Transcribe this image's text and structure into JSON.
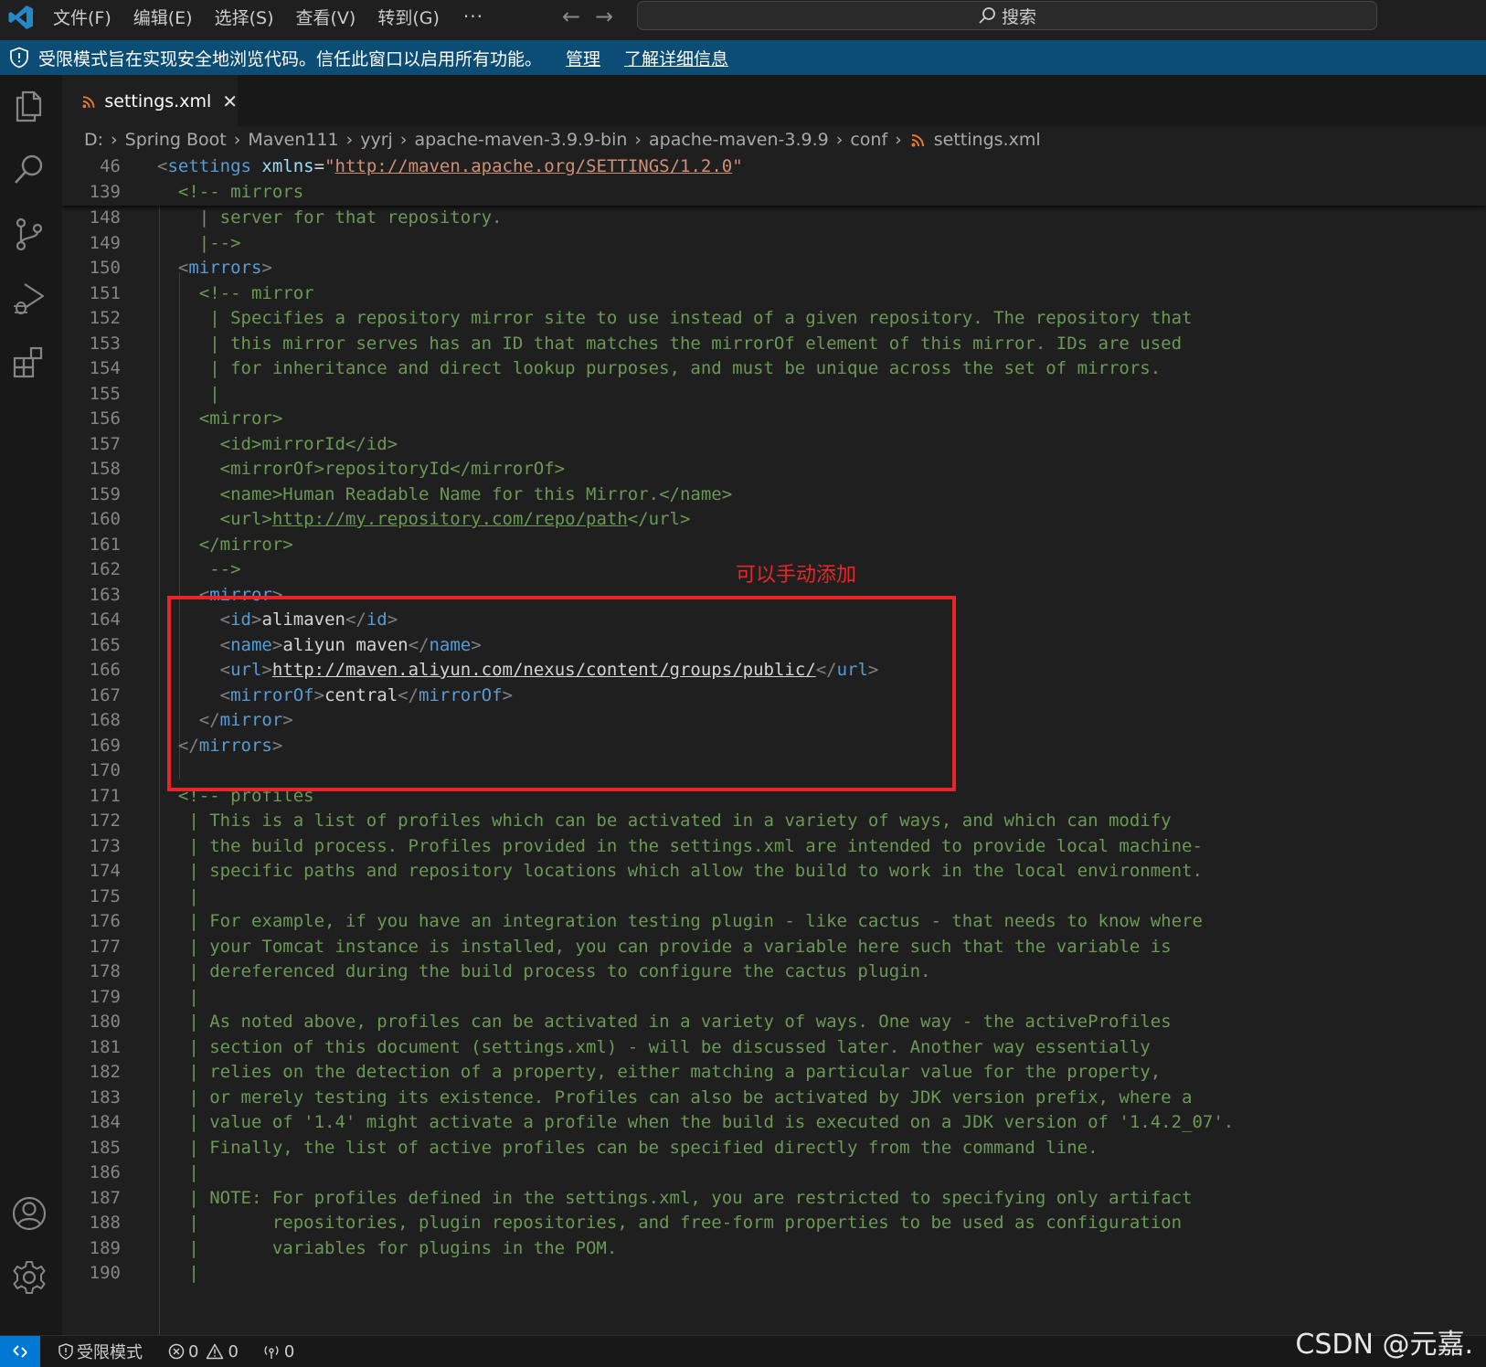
{
  "menu": [
    "文件(F)",
    "编辑(E)",
    "选择(S)",
    "查看(V)",
    "转到(G)"
  ],
  "menu_more": "···",
  "nav": {
    "back": "←",
    "forward": "→"
  },
  "search": {
    "label": "搜索"
  },
  "banner": {
    "message": "受限模式旨在实现安全地浏览代码。信任此窗口以启用所有功能。",
    "manage": "管理",
    "learn_more": "了解详细信息"
  },
  "tab": {
    "label": "settings.xml",
    "close": "✕"
  },
  "breadcrumb": [
    "D:",
    "Spring Boot",
    "Maven111",
    "yyrj",
    "apache-maven-3.9.9-bin",
    "apache-maven-3.9.9",
    "conf",
    "settings.xml"
  ],
  "breadcrumb_sep": "›",
  "editor": {
    "sticky": [
      {
        "n": "46",
        "tokens": [
          [
            "p",
            "<"
          ],
          [
            "t",
            "settings"
          ],
          [
            "d",
            " "
          ],
          [
            "a",
            "xmlns"
          ],
          [
            "d",
            "="
          ],
          [
            "s",
            "\""
          ],
          [
            "su",
            "http://maven.apache.org/SETTINGS/1.2.0"
          ],
          [
            "s",
            "\""
          ]
        ]
      },
      {
        "n": "139",
        "tokens": [
          [
            "d",
            "  "
          ],
          [
            "c",
            "<!-- mirrors"
          ]
        ]
      }
    ],
    "lines": [
      {
        "n": "148",
        "tokens": [
          [
            "c",
            "    | server for that repository."
          ]
        ]
      },
      {
        "n": "149",
        "tokens": [
          [
            "c",
            "    |-->"
          ]
        ]
      },
      {
        "n": "150",
        "tokens": [
          [
            "d",
            "  "
          ],
          [
            "p",
            "<"
          ],
          [
            "t",
            "mirrors"
          ],
          [
            "p",
            ">"
          ]
        ]
      },
      {
        "n": "151",
        "tokens": [
          [
            "c",
            "    <!-- mirror"
          ]
        ]
      },
      {
        "n": "152",
        "tokens": [
          [
            "c",
            "     | Specifies a repository mirror site to use instead of a given repository. The repository that"
          ]
        ]
      },
      {
        "n": "153",
        "tokens": [
          [
            "c",
            "     | this mirror serves has an ID that matches the mirrorOf element of this mirror. IDs are used"
          ]
        ]
      },
      {
        "n": "154",
        "tokens": [
          [
            "c",
            "     | for inheritance and direct lookup purposes, and must be unique across the set of mirrors."
          ]
        ]
      },
      {
        "n": "155",
        "tokens": [
          [
            "c",
            "     |"
          ]
        ]
      },
      {
        "n": "156",
        "tokens": [
          [
            "c",
            "    <mirror>"
          ]
        ]
      },
      {
        "n": "157",
        "tokens": [
          [
            "c",
            "      <id>mirrorId</id>"
          ]
        ]
      },
      {
        "n": "158",
        "tokens": [
          [
            "c",
            "      <mirrorOf>repositoryId</mirrorOf>"
          ]
        ]
      },
      {
        "n": "159",
        "tokens": [
          [
            "c",
            "      <name>Human Readable Name for this Mirror.</name>"
          ]
        ]
      },
      {
        "n": "160",
        "tokens": [
          [
            "c",
            "      <url>"
          ],
          [
            "cu",
            "http://my.repository.com/repo/path"
          ],
          [
            "c",
            "</url>"
          ]
        ]
      },
      {
        "n": "161",
        "tokens": [
          [
            "c",
            "    </mirror>"
          ]
        ]
      },
      {
        "n": "162",
        "tokens": [
          [
            "c",
            "     -->"
          ]
        ]
      },
      {
        "n": "163",
        "tokens": [
          [
            "d",
            "    "
          ],
          [
            "p",
            "<"
          ],
          [
            "t",
            "mirror"
          ],
          [
            "p",
            ">"
          ]
        ]
      },
      {
        "n": "164",
        "tokens": [
          [
            "d",
            "      "
          ],
          [
            "p",
            "<"
          ],
          [
            "t",
            "id"
          ],
          [
            "p",
            ">"
          ],
          [
            "d",
            "alimaven"
          ],
          [
            "p",
            "</"
          ],
          [
            "t",
            "id"
          ],
          [
            "p",
            ">"
          ]
        ]
      },
      {
        "n": "165",
        "tokens": [
          [
            "d",
            "      "
          ],
          [
            "p",
            "<"
          ],
          [
            "t",
            "name"
          ],
          [
            "p",
            ">"
          ],
          [
            "d",
            "aliyun maven"
          ],
          [
            "p",
            "</"
          ],
          [
            "t",
            "name"
          ],
          [
            "p",
            ">"
          ]
        ]
      },
      {
        "n": "166",
        "tokens": [
          [
            "d",
            "      "
          ],
          [
            "p",
            "<"
          ],
          [
            "t",
            "url"
          ],
          [
            "p",
            ">"
          ],
          [
            "tu",
            "http://maven.aliyun.com/nexus/content/groups/public/"
          ],
          [
            "p",
            "</"
          ],
          [
            "t",
            "url"
          ],
          [
            "p",
            ">"
          ]
        ]
      },
      {
        "n": "167",
        "tokens": [
          [
            "d",
            "      "
          ],
          [
            "p",
            "<"
          ],
          [
            "t",
            "mirrorOf"
          ],
          [
            "p",
            ">"
          ],
          [
            "d",
            "central"
          ],
          [
            "p",
            "</"
          ],
          [
            "t",
            "mirrorOf"
          ],
          [
            "p",
            ">"
          ]
        ]
      },
      {
        "n": "168",
        "tokens": [
          [
            "d",
            "    "
          ],
          [
            "p",
            "</"
          ],
          [
            "t",
            "mirror"
          ],
          [
            "p",
            ">"
          ]
        ]
      },
      {
        "n": "169",
        "tokens": [
          [
            "d",
            "  "
          ],
          [
            "p",
            "</"
          ],
          [
            "t",
            "mirrors"
          ],
          [
            "p",
            ">"
          ]
        ]
      },
      {
        "n": "170",
        "tokens": [
          [
            "d",
            ""
          ]
        ]
      },
      {
        "n": "171",
        "tokens": [
          [
            "c",
            "  <!-- profiles"
          ]
        ]
      },
      {
        "n": "172",
        "tokens": [
          [
            "c",
            "   | This is a list of profiles which can be activated in a variety of ways, and which can modify"
          ]
        ]
      },
      {
        "n": "173",
        "tokens": [
          [
            "c",
            "   | the build process. Profiles provided in the settings.xml are intended to provide local machine-"
          ]
        ]
      },
      {
        "n": "174",
        "tokens": [
          [
            "c",
            "   | specific paths and repository locations which allow the build to work in the local environment."
          ]
        ]
      },
      {
        "n": "175",
        "tokens": [
          [
            "c",
            "   |"
          ]
        ]
      },
      {
        "n": "176",
        "tokens": [
          [
            "c",
            "   | For example, if you have an integration testing plugin - like cactus - that needs to know where"
          ]
        ]
      },
      {
        "n": "177",
        "tokens": [
          [
            "c",
            "   | your Tomcat instance is installed, you can provide a variable here such that the variable is"
          ]
        ]
      },
      {
        "n": "178",
        "tokens": [
          [
            "c",
            "   | dereferenced during the build process to configure the cactus plugin."
          ]
        ]
      },
      {
        "n": "179",
        "tokens": [
          [
            "c",
            "   |"
          ]
        ]
      },
      {
        "n": "180",
        "tokens": [
          [
            "c",
            "   | As noted above, profiles can be activated in a variety of ways. One way - the activeProfiles"
          ]
        ]
      },
      {
        "n": "181",
        "tokens": [
          [
            "c",
            "   | section of this document (settings.xml) - will be discussed later. Another way essentially"
          ]
        ]
      },
      {
        "n": "182",
        "tokens": [
          [
            "c",
            "   | relies on the detection of a property, either matching a particular value for the property,"
          ]
        ]
      },
      {
        "n": "183",
        "tokens": [
          [
            "c",
            "   | or merely testing its existence. Profiles can also be activated by JDK version prefix, where a"
          ]
        ]
      },
      {
        "n": "184",
        "tokens": [
          [
            "c",
            "   | value of '1.4' might activate a profile when the build is executed on a JDK version of '1.4.2_07'."
          ]
        ]
      },
      {
        "n": "185",
        "tokens": [
          [
            "c",
            "   | Finally, the list of active profiles can be specified directly from the command line."
          ]
        ]
      },
      {
        "n": "186",
        "tokens": [
          [
            "c",
            "   |"
          ]
        ]
      },
      {
        "n": "187",
        "tokens": [
          [
            "c",
            "   | NOTE: For profiles defined in the settings.xml, you are restricted to specifying only artifact"
          ]
        ]
      },
      {
        "n": "188",
        "tokens": [
          [
            "c",
            "   |       repositories, plugin repositories, and free-form properties to be used as configuration"
          ]
        ]
      },
      {
        "n": "189",
        "tokens": [
          [
            "c",
            "   |       variables for plugins in the POM."
          ]
        ]
      },
      {
        "n": "190",
        "tokens": [
          [
            "c",
            "   |"
          ]
        ]
      }
    ]
  },
  "annotation": {
    "text": "可以手动添加",
    "color": "#e8262a"
  },
  "status": {
    "restricted": "受限模式",
    "errors": "0",
    "warnings": "0",
    "ports": "0"
  },
  "watermark": "CSDN @元嘉.",
  "colors": {
    "accent": "#0078d4",
    "banner": "#0b4d75",
    "comment": "#6a9955",
    "tag": "#569cd6",
    "attribute": "#9cdcfe",
    "string": "#ce9178",
    "annotation_red": "#e8262a"
  },
  "icons": {
    "logo": "vscode-logo",
    "activity": [
      "explorer-icon",
      "search-icon",
      "source-control-icon",
      "run-debug-icon",
      "extensions-icon",
      "account-icon",
      "settings-gear-icon"
    ],
    "file": "rss-xml-file-icon"
  }
}
